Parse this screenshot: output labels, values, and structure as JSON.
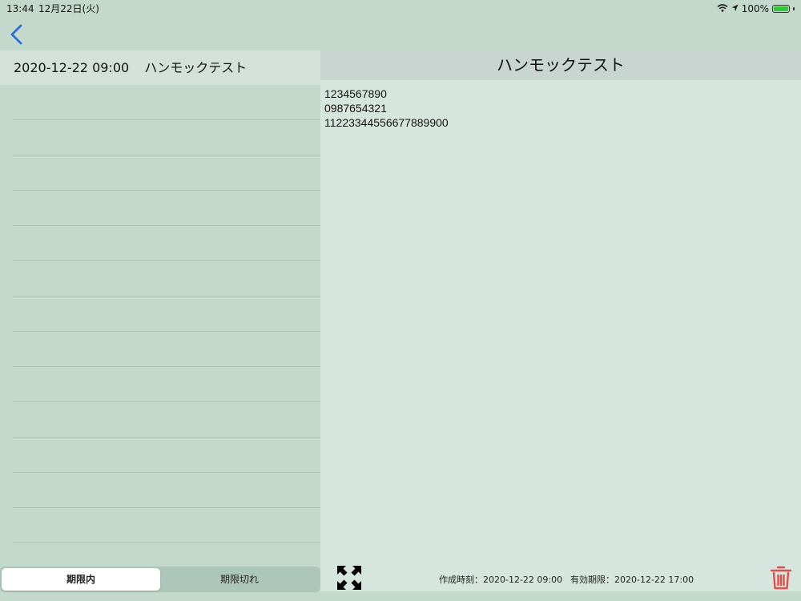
{
  "status_bar": {
    "time": "13:44",
    "date": "12月22日(火)",
    "battery": "100%",
    "battery_level": 1.0
  },
  "nav": {
    "back_icon": "chevron-left-icon",
    "accent_color": "#2c6fd6"
  },
  "list": {
    "selected_item": {
      "datetime": "2020-12-22 09:00",
      "title": "ハンモックテスト"
    },
    "empty_row_count": 13
  },
  "segments": {
    "items": [
      {
        "label": "期限内",
        "selected": true
      },
      {
        "label": "期限切れ",
        "selected": false
      }
    ]
  },
  "detail": {
    "title": "ハンモックテスト",
    "body": "1234567890\n0987654321\n11223344556677889900",
    "created_label": "作成時刻：",
    "created_value": "2020-12-22 09:00",
    "expiry_label": "有効期限：",
    "expiry_value": "2020-12-22 17:00",
    "expand_icon": "expand-arrows-icon",
    "delete_icon": "trash-icon",
    "delete_color": "#e0504a"
  },
  "colors": {
    "background": "#c3d9cc",
    "header_bg": "#d4e1da",
    "detail_bg": "#d7e5df",
    "detail_title_bg": "#c9d5d1"
  }
}
